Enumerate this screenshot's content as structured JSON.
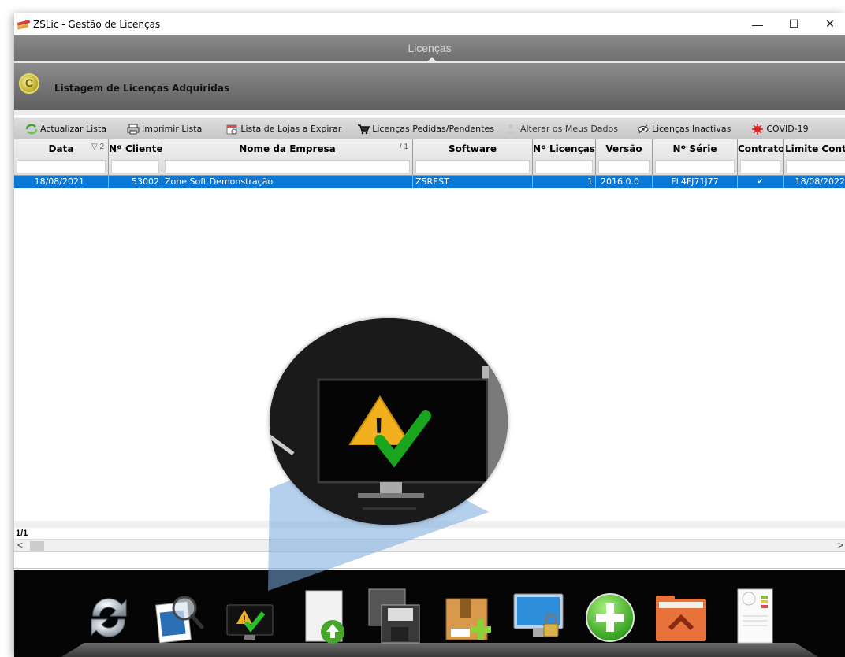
{
  "window": {
    "title": "ZSLic - Gestão de Licenças",
    "controls": {
      "minimize": "—",
      "maximize": "☐",
      "close": "✕"
    }
  },
  "header": {
    "title": "Licenças"
  },
  "subheader": {
    "title": "Listagem de Licenças Adquiridas"
  },
  "toolbar": {
    "items": [
      {
        "label": "Actualizar Lista",
        "icon": "refresh-icon"
      },
      {
        "label": "Imprimir Lista",
        "icon": "printer-icon"
      },
      {
        "label": "Lista de Lojas a Expirar",
        "icon": "calendar-icon"
      },
      {
        "label": "Licenças Pedidas/Pendentes",
        "icon": "cart-icon"
      },
      {
        "label": "Alterar os Meus Dados",
        "icon": "user-icon"
      },
      {
        "label": "Licenças Inactivas",
        "icon": "eye-icon"
      },
      {
        "label": "COVID-19",
        "icon": "virus-icon"
      }
    ]
  },
  "grid": {
    "columns": [
      {
        "label": "Data",
        "sort": "▽ 2"
      },
      {
        "label": "Nº Cliente",
        "sort": ""
      },
      {
        "label": "Nome da Empresa",
        "sort": "/ 1"
      },
      {
        "label": "Software",
        "sort": ""
      },
      {
        "label": "Nº Licenças",
        "sort": ""
      },
      {
        "label": "Versão",
        "sort": ""
      },
      {
        "label": "Nº Série",
        "sort": ""
      },
      {
        "label": "Contrato",
        "sort": ""
      },
      {
        "label": "Limite Contr...",
        "sort": ""
      }
    ],
    "rows": [
      {
        "data": "18/08/2021",
        "cliente": "53002",
        "empresa": "Zone Soft Demonstração",
        "software": "ZSREST",
        "licencas": "1",
        "versao": "2016.0.0",
        "serie": "FL4FJ71J77",
        "contrato": "✔",
        "limite": "18/08/2022"
      }
    ]
  },
  "pager": {
    "text": "1/1"
  },
  "scroll": {
    "left": "<",
    "right": ">"
  },
  "dock": {
    "icons": [
      "refresh-dock-icon",
      "search-document-icon",
      "monitor-warning-icon",
      "upload-document-icon",
      "floppy-disk-icon",
      "package-add-icon",
      "monitor-lock-icon",
      "add-circle-icon",
      "folder-home-icon",
      "certificate-document-icon"
    ]
  },
  "colors": {
    "selection": "#0a78d7",
    "header_gray": "#7a7a7a",
    "dock_bg": "#050505"
  }
}
